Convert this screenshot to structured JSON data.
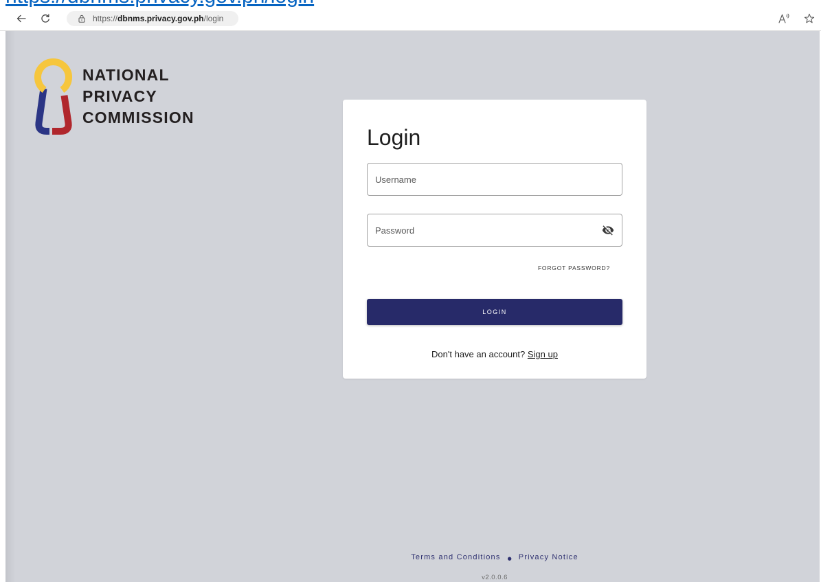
{
  "document": {
    "hyperlink_text": "https://dbnms.privacy.gov.ph/login"
  },
  "browser": {
    "back_icon": "arrow-left-icon",
    "reload_icon": "reload-icon",
    "address": {
      "lock_icon": "lock-icon",
      "scheme": "https://",
      "host": "dbnms.privacy.gov.ph",
      "path": "/login"
    },
    "read_aloud_icon": "read-aloud-icon",
    "favorite_icon": "star-outline-icon"
  },
  "brand": {
    "logo_icon": "keyhole-logo-icon",
    "lines": [
      "NATIONAL",
      "PRIVACY",
      "COMMISSION"
    ]
  },
  "login": {
    "title": "Login",
    "username_placeholder": "Username",
    "password_placeholder": "Password",
    "password_toggle_icon": "eye-off-icon",
    "forgot_password": "FORGOT PASSWORD?",
    "submit_label": "LOGIN",
    "signup_prompt": "Don't have an account?",
    "signup_link": "Sign up"
  },
  "footer": {
    "terms": "Terms and Conditions",
    "separator": "●",
    "privacy": "Privacy Notice",
    "version": "v2.0.0.6"
  },
  "colors": {
    "page_bg": "#d1d3d9",
    "card_bg": "#ffffff",
    "primary": "#272a69",
    "hyperlink": "#0563c1",
    "footer_link": "#2e3070",
    "brand_text": "#231f20",
    "brand_yellow": "#f6c63d",
    "brand_blue": "#2b3585",
    "brand_red": "#b0262c"
  }
}
